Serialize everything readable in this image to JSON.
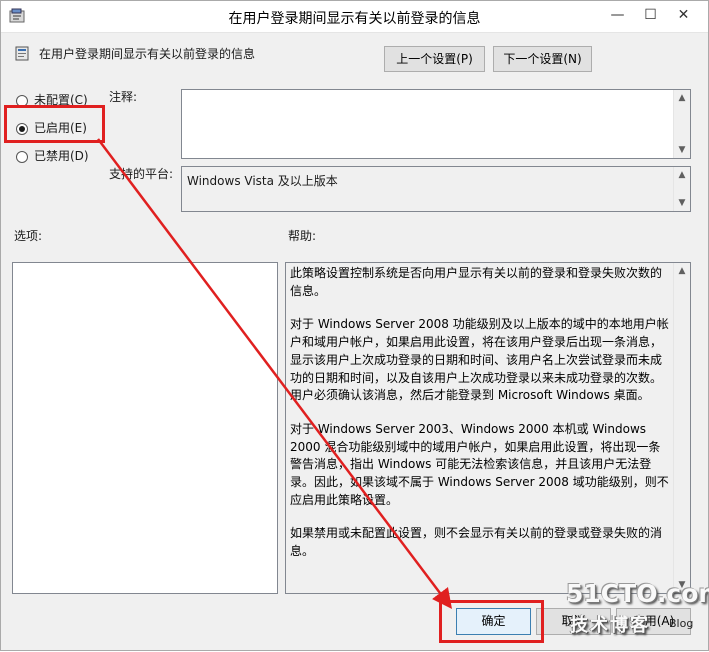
{
  "window": {
    "title": "在用户登录期间显示有关以前登录的信息",
    "minimize_glyph": "—",
    "maximize_glyph": "☐",
    "close_glyph": "✕"
  },
  "header": {
    "setting_name": "在用户登录期间显示有关以前登录的信息",
    "prev_button": "上一个设置(P)",
    "next_button": "下一个设置(N)"
  },
  "state": {
    "options": [
      {
        "label": "未配置(C)",
        "selected": false
      },
      {
        "label": "已启用(E)",
        "selected": true
      },
      {
        "label": "已禁用(D)",
        "selected": false
      }
    ]
  },
  "comment": {
    "label": "注释:",
    "value": ""
  },
  "platform": {
    "label": "支持的平台:",
    "value": "Windows Vista 及以上版本"
  },
  "options_panel": {
    "label": "选项:"
  },
  "help_panel": {
    "label": "帮助:",
    "paragraphs": [
      "此策略设置控制系统是否向用户显示有关以前的登录和登录失败次数的信息。",
      "对于 Windows Server 2008 功能级别及以上版本的域中的本地用户帐户和域用户帐户，如果启用此设置，将在该用户登录后出现一条消息，显示该用户上次成功登录的日期和时间、该用户名上次尝试登录而未成功的日期和时间，以及自该用户上次成功登录以来未成功登录的次数。用户必须确认该消息，然后才能登录到 Microsoft Windows 桌面。",
      "对于 Windows Server 2003、Windows 2000 本机或 Windows 2000 混合功能级别域中的域用户帐户，如果启用此设置，将出现一条警告消息，指出 Windows 可能无法检索该信息，并且该用户无法登录。因此，如果该域不属于 Windows Server 2008 域功能级别，则不应启用此策略设置。",
      "如果禁用或未配置此设置，则不会显示有关以前的登录或登录失败的消息。"
    ]
  },
  "footer": {
    "ok_button": "确定",
    "cancel_button": "取消",
    "apply_button": "应用(A)"
  },
  "watermark": {
    "main": "51CTO.com",
    "sub": "技术博客",
    "blog": "Blog"
  },
  "annotation_color": "#e02020"
}
